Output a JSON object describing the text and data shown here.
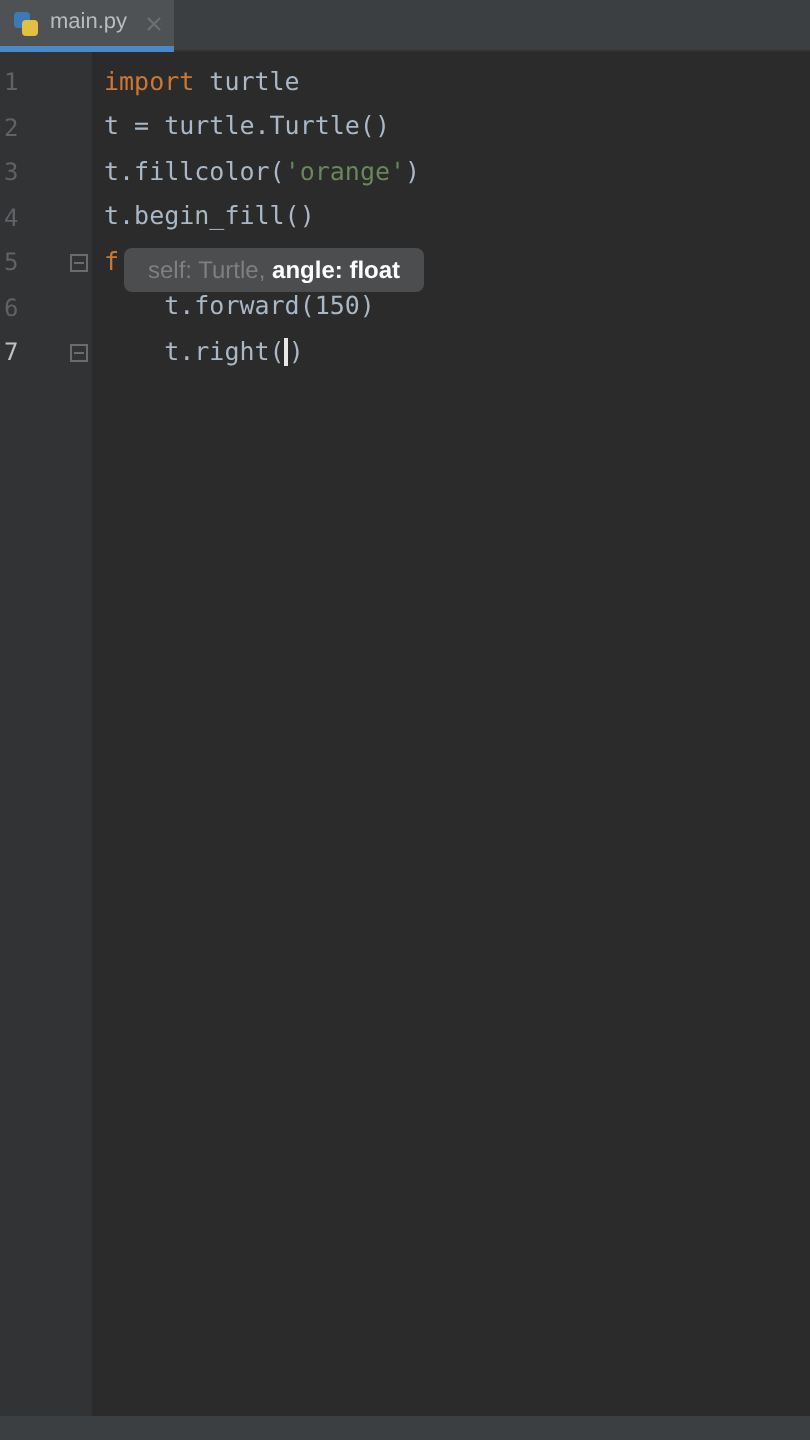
{
  "tabs": [
    {
      "label": "main.py",
      "selected": true
    }
  ],
  "lines": [
    {
      "number": "1",
      "current": false,
      "tokens": [
        {
          "text": "import",
          "kind": "keyword"
        },
        {
          "text": " turtle",
          "kind": "plain"
        }
      ]
    },
    {
      "number": "2",
      "current": false,
      "tokens": [
        {
          "text": "t = turtle.Turtle()",
          "kind": "plain"
        }
      ]
    },
    {
      "number": "3",
      "current": false,
      "tokens": [
        {
          "text": "t.fillcolor(",
          "kind": "plain"
        },
        {
          "text": "'orange'",
          "kind": "string"
        },
        {
          "text": ")",
          "kind": "plain"
        }
      ]
    },
    {
      "number": "4",
      "current": false,
      "tokens": [
        {
          "text": "t.begin_fill()",
          "kind": "plain"
        }
      ]
    },
    {
      "number": "5",
      "current": false,
      "fold": true,
      "tokens": [
        {
          "text": "f",
          "kind": "keyword"
        }
      ]
    },
    {
      "number": "6",
      "current": false,
      "tokens": [
        {
          "text": "    t.forward(150)",
          "kind": "plain"
        }
      ]
    },
    {
      "number": "7",
      "current": true,
      "fold": true,
      "tokens": [
        {
          "text": "    t.right(",
          "kind": "plain"
        },
        {
          "text": ")",
          "kind": "plain"
        }
      ]
    }
  ],
  "tooltip": {
    "parts": [
      {
        "text": "self: Turtle, ",
        "kind": "dim"
      },
      {
        "text": "angle: float",
        "kind": "current"
      }
    ]
  }
}
